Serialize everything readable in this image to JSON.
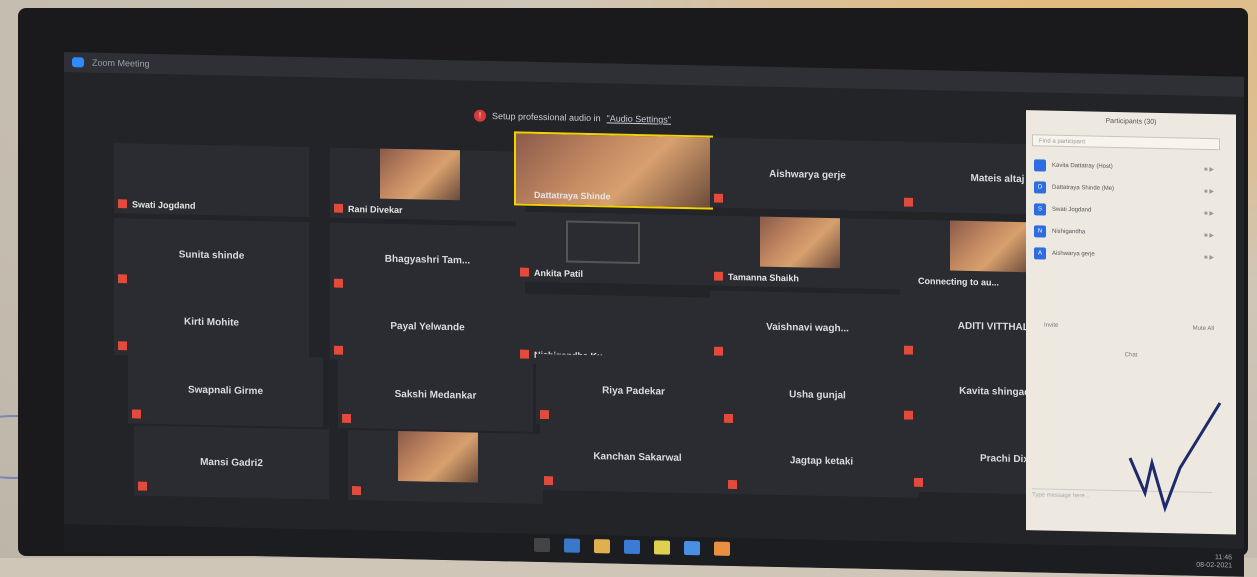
{
  "window": {
    "title": "Zoom Meeting"
  },
  "banner": {
    "text": "Setup professional audio in ",
    "link": "\"Audio Settings\""
  },
  "participants": [
    {
      "name": "Swati Jogdand",
      "style": "corner",
      "muted": true
    },
    {
      "name": "Rani Divekar",
      "style": "corner",
      "muted": true,
      "video": true
    },
    {
      "name": "Dattatraya Shinde",
      "style": "corner",
      "muted": false,
      "video": true,
      "active": true
    },
    {
      "name": "Aishwarya gerje",
      "style": "center",
      "muted": true
    },
    {
      "name": "Mateis altaj",
      "style": "center",
      "muted": true
    },
    {
      "name": "Sunita shinde",
      "style": "center",
      "muted": true
    },
    {
      "name": "Bhagyashri Tam...",
      "style": "center",
      "muted": true
    },
    {
      "name": "Ankita Patil",
      "style": "corner",
      "muted": true,
      "envelope": true
    },
    {
      "name": "Tamanna Shaikh",
      "style": "corner",
      "muted": true,
      "video": true
    },
    {
      "name": "Connecting to au...",
      "style": "corner",
      "muted": false,
      "video": true
    },
    {
      "name": "Kirti Mohite",
      "style": "center",
      "muted": true
    },
    {
      "name": "Payal Yelwande",
      "style": "center",
      "muted": true
    },
    {
      "name": "Nishigandha Ku...",
      "style": "corner",
      "muted": true
    },
    {
      "name": "Vaishnavi wagh...",
      "style": "center",
      "muted": true
    },
    {
      "name": "ADITI VITTHAL...",
      "style": "center",
      "muted": true
    },
    {
      "name": "Swapnali Girme",
      "style": "center",
      "muted": true
    },
    {
      "name": "Sakshi Medankar",
      "style": "center",
      "muted": true
    },
    {
      "name": "Riya Padekar",
      "style": "center",
      "muted": true
    },
    {
      "name": "Usha gunjal",
      "style": "center",
      "muted": true
    },
    {
      "name": "Kavita shingade",
      "style": "center",
      "muted": true
    },
    {
      "name": "Mansi Gadri2",
      "style": "center",
      "muted": true
    },
    {
      "name": "",
      "style": "corner",
      "muted": true,
      "video": true
    },
    {
      "name": "Kanchan Sakarwal",
      "style": "center",
      "muted": true
    },
    {
      "name": "Jagtap ketaki",
      "style": "center",
      "muted": true
    },
    {
      "name": "Prachi Dixit",
      "style": "center",
      "muted": true
    }
  ],
  "panel": {
    "title": "Participants (30)",
    "search_placeholder": "Find a participant",
    "rows": [
      {
        "initial": "",
        "name": "Kavita Dattatray (Host)"
      },
      {
        "initial": "D",
        "name": "Dattatraya Shinde (Me)"
      },
      {
        "initial": "S",
        "name": "Swati Jogdand"
      },
      {
        "initial": "N",
        "name": "Nishigandha"
      },
      {
        "initial": "A",
        "name": "Aishwarya gerje"
      }
    ],
    "invite_label": "Invite",
    "mute_all_label": "Mute All",
    "chat_label": "Chat",
    "chat_placeholder": "Type message here..."
  },
  "taskbar": {
    "time": "11:46",
    "date": "08-02-2021"
  },
  "colors": {
    "mute": "#e24b3b",
    "active_speaker": "#f2d200",
    "tile": "#2a2c31",
    "panel_bg": "#ede9e1"
  }
}
